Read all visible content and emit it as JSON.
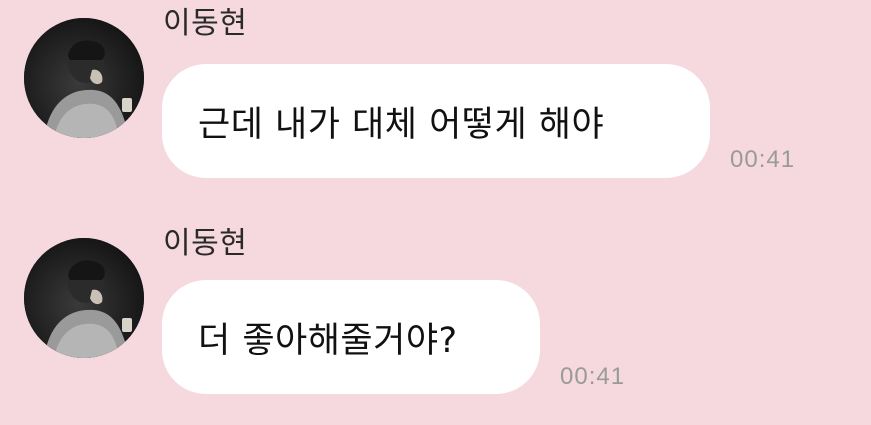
{
  "chat": {
    "background_color": "#f5d9df",
    "messages": [
      {
        "sender": "이동현",
        "avatar_icon": "profile-photo",
        "text": "근데 내가 대체 어떻게 해야",
        "time": "00:41"
      },
      {
        "sender": "이동현",
        "avatar_icon": "profile-photo",
        "text": "더 좋아해줄거야?",
        "time": "00:41"
      }
    ]
  }
}
